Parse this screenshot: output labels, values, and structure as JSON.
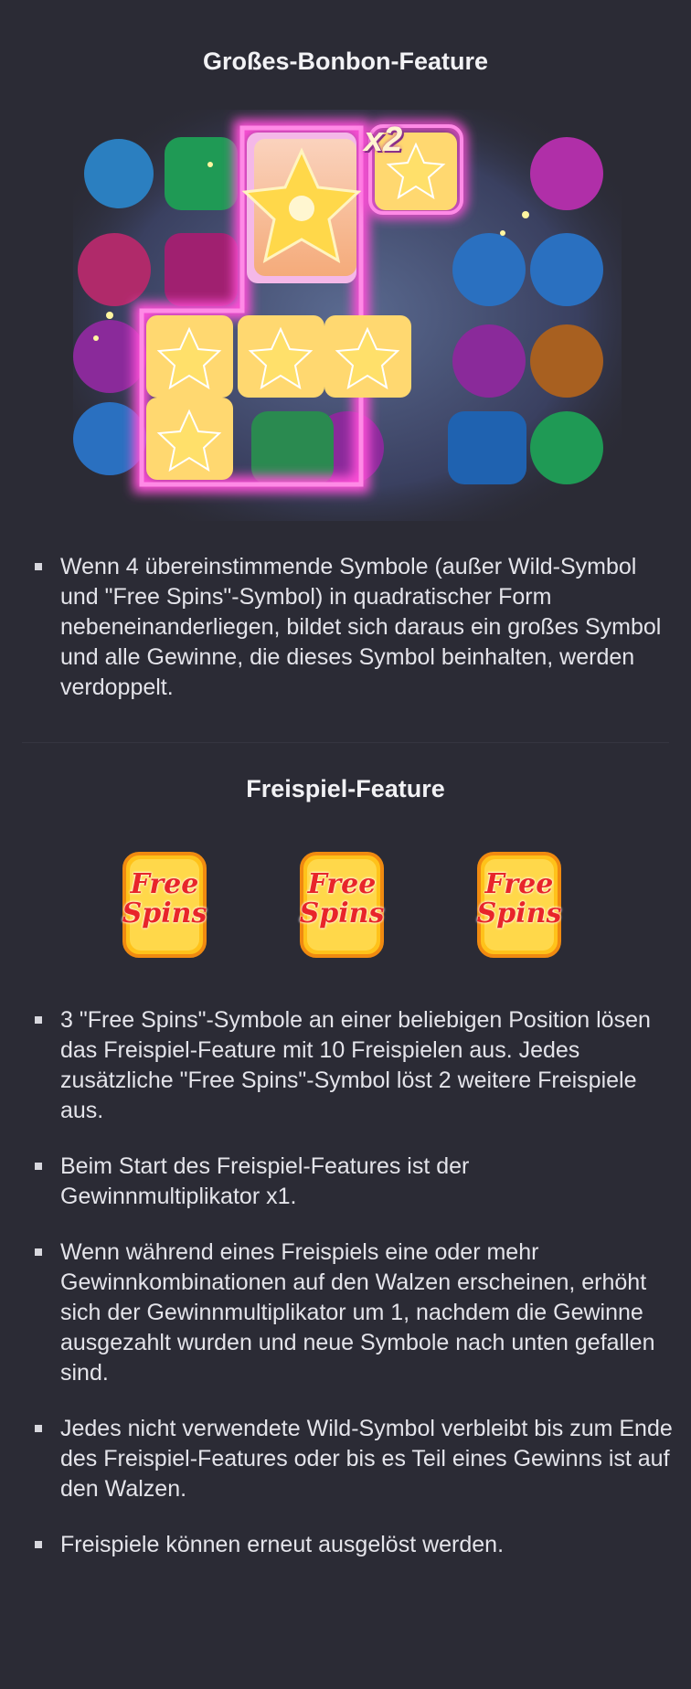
{
  "sections": {
    "bonbon": {
      "title": "Großes-Bonbon-Feature",
      "multiplier_badge": "x2",
      "bullets": [
        "Wenn 4 übereinstimmende Symbole (außer Wild-Symbol und \"Free Spins\"-Symbol) in quadratischer Form nebeneinanderliegen, bildet sich daraus ein großes Symbol und alle Gewinne, die dieses Symbol beinhalten, werden verdoppelt."
      ]
    },
    "freespin": {
      "title": "Freispiel-Feature",
      "icon_line1": "Free",
      "icon_line2": "Spins",
      "bullets": [
        "3 \"Free Spins\"-Symbole an einer beliebigen Position lösen das Freispiel-Feature mit 10 Freispielen aus. Jedes zusätzliche \"Free Spins\"-Symbol löst 2 weitere Freispiele aus.",
        "Beim Start des Freispiel-Features ist der Gewinnmultiplikator x1.",
        "Wenn während eines Freispiels eine oder mehr Gewinnkombinationen auf den Walzen erscheinen, erhöht sich der Gewinnmultiplikator um 1, nachdem die Gewinne ausgezahlt wurden und neue Symbole nach unten gefallen sind.",
        "Jedes nicht verwendete Wild-Symbol verbleibt bis zum Ende des Freispiel-Features oder bis es Teil eines Gewinns ist auf den Walzen.",
        "Freispiele können erneut ausgelöst werden."
      ]
    }
  },
  "colors": {
    "background": "#2b2b35",
    "highlight_pink": "#ff4fd8",
    "star_yellow": "#ffd84a",
    "free_spins_red": "#e8252a",
    "free_spins_gold": "#ffc21a"
  },
  "icons": [
    "star-candy-icon",
    "free-spins-icon"
  ]
}
